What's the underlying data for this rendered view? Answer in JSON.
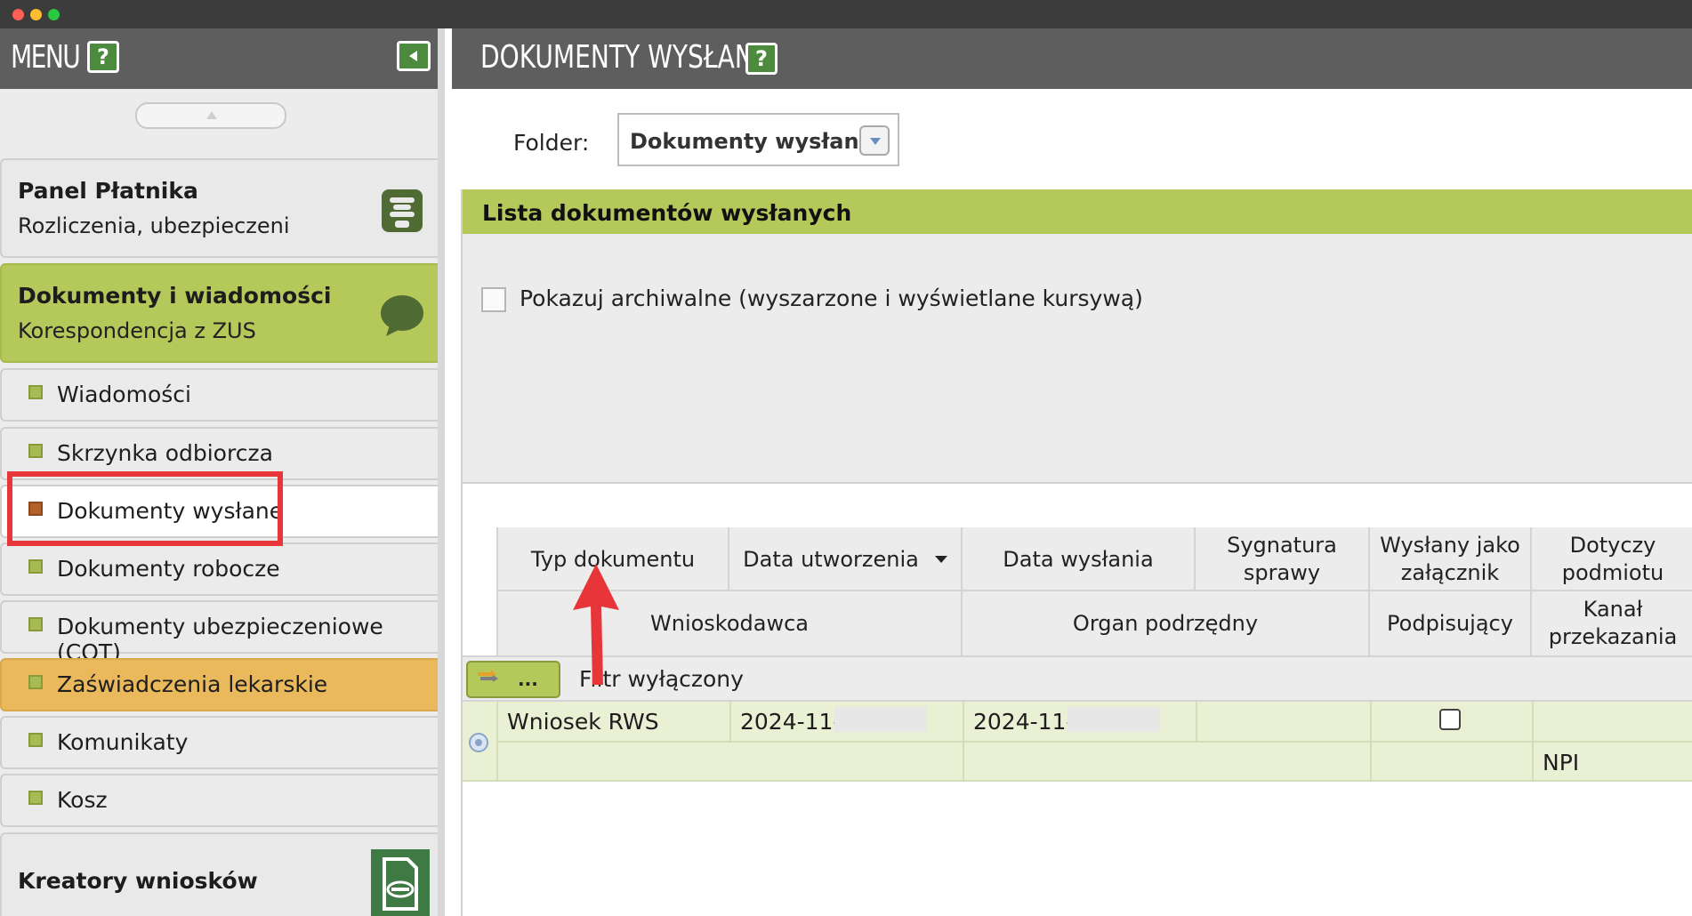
{
  "window": {
    "controls": [
      "close",
      "minimize",
      "zoom"
    ]
  },
  "sidebar": {
    "title": "MENU",
    "help_label": "?",
    "panels": [
      {
        "title": "Panel Płatnika",
        "subtitle": "Rozliczenia, ubezpieczeni",
        "icon": "payer-panel-icon"
      },
      {
        "title": "Dokumenty i wiadomości",
        "subtitle": "Korespondencja z ZUS",
        "icon": "speech-bubble-icon"
      }
    ],
    "items": [
      {
        "label": "Wiadomości"
      },
      {
        "label": "Skrzynka odbiorcza"
      },
      {
        "label": "Dokumenty wysłane",
        "active": true
      },
      {
        "label": "Dokumenty robocze"
      },
      {
        "label": "Dokumenty ubezpieczeniowe (COT)"
      },
      {
        "label": "Zaświadczenia lekarskie",
        "highlight": "#e9b95c"
      },
      {
        "label": "Komunikaty"
      },
      {
        "label": "Kosz"
      }
    ],
    "footer_panel": {
      "title": "Kreatory wniosków",
      "icon": "document-form-icon"
    }
  },
  "main": {
    "title": "DOKUMENTY WYSŁANE",
    "help_label": "?",
    "folder": {
      "label": "Folder:",
      "value": "Dokumenty wysłane"
    },
    "list": {
      "title": "Lista dokumentów wysłanych",
      "archive_checkbox_label": "Pokazuj archiwalne (wyszarzone i wyświetlane kursywą)",
      "headers_row1": [
        "Typ dokumentu",
        "Data utworzenia",
        "Data wysłania",
        "Sygnatura sprawy",
        "Wysłany jako załącznik",
        "Dotyczy podmiotu"
      ],
      "headers_row2": [
        "Wnioskodawca",
        "Organ podrzędny",
        "Podpisujący",
        "Kanał przekazania"
      ],
      "filter_button_label": "...",
      "filter_status": "Filtr wyłączony",
      "rows": [
        {
          "typ_dokumentu": "Wniosek RWS",
          "data_utworzenia": "2024-11-",
          "data_wyslania": "2024-11-",
          "sygnatura_sprawy": "",
          "wyslany_jako_zalacznik": false,
          "dotyczy_podmiotu": "",
          "kanal_przekazania": "NPI"
        }
      ]
    }
  },
  "colors": {
    "header_bg": "#5e5e5e",
    "accent_green": "#b5c85a",
    "highlight_orange": "#e9b95c",
    "annotation_red": "#e8353a",
    "row_bg": "#eaf0d4"
  }
}
